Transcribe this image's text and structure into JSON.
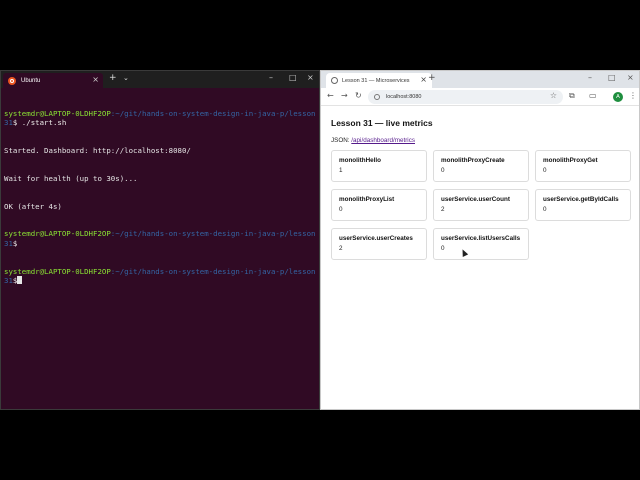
{
  "terminal": {
    "tab_title": "Ubuntu",
    "lines": [
      {
        "user": "systemdr@LAPTOP-0LDHF2OP",
        "path": ":~/git/hands-on-system-design-in-java-p/lesson31",
        "cmd": "$ ./start.sh"
      },
      {
        "text": "Started. Dashboard: http://localhost:8080/"
      },
      {
        "text": "Wait for health (up to 30s)..."
      },
      {
        "text": "OK (after 4s)"
      },
      {
        "user": "systemdr@LAPTOP-0LDHF2OP",
        "path": ":~/git/hands-on-system-design-in-java-p/lesson31",
        "cmd": "$"
      },
      {
        "user": "systemdr@LAPTOP-0LDHF2OP",
        "path": ":~/git/hands-on-system-design-in-java-p/lesson31",
        "cmd": "$"
      }
    ]
  },
  "browser": {
    "tab_title": "Lesson 31 — Microservices",
    "url": "localhost:8080",
    "avatar_letter": "A",
    "page": {
      "title": "Lesson 31 — live metrics",
      "json_label": "JSON:",
      "json_link": "/api/dashboard/metrics",
      "metrics": [
        {
          "name": "monolithHello",
          "value": "1"
        },
        {
          "name": "monolithProxyCreate",
          "value": "0"
        },
        {
          "name": "monolithProxyGet",
          "value": "0"
        },
        {
          "name": "monolithProxyList",
          "value": "0"
        },
        {
          "name": "userService.userCount",
          "value": "2"
        },
        {
          "name": "userService.getByIdCalls",
          "value": "0"
        },
        {
          "name": "userService.userCreates",
          "value": "2"
        },
        {
          "name": "userService.listUsersCalls",
          "value": "0"
        }
      ]
    }
  },
  "colors": {
    "terminal_bg": "#300a24",
    "prompt_user": "#8ae234",
    "prompt_path": "#3465a4",
    "link": "#551a8b"
  }
}
